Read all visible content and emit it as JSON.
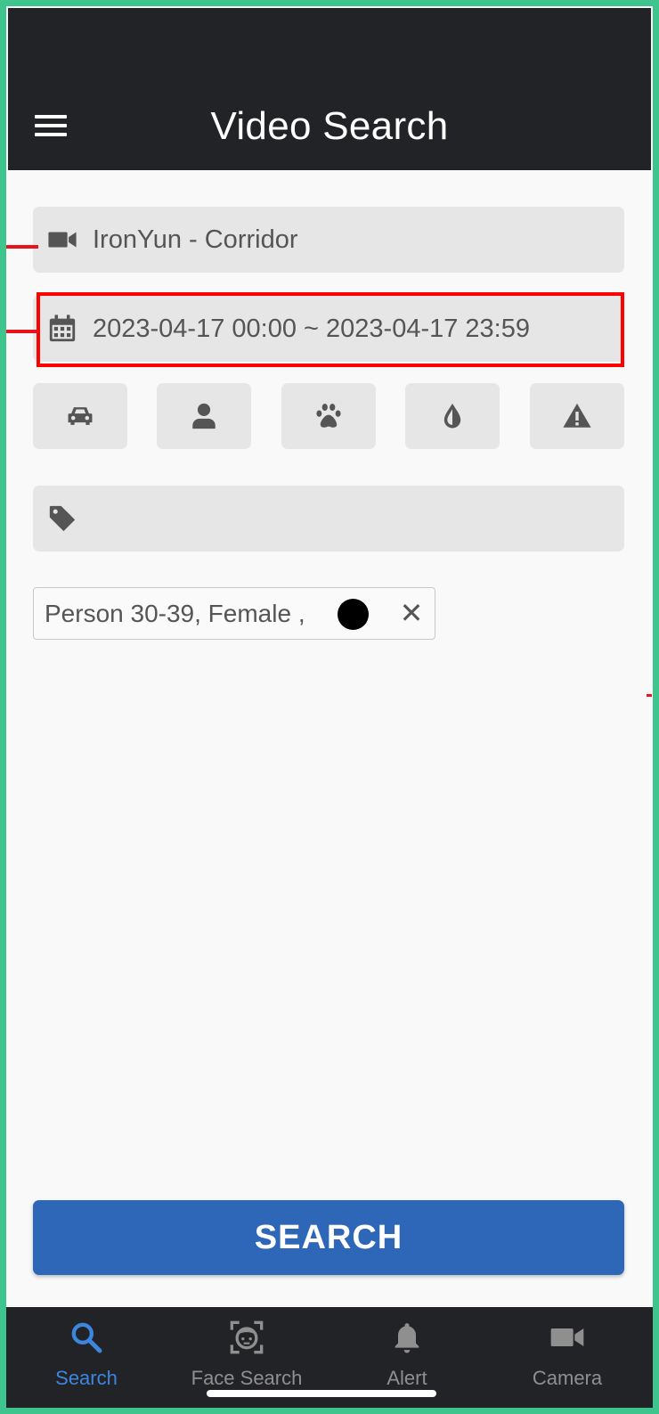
{
  "header": {
    "title": "Video Search"
  },
  "camera_field": {
    "value": "IronYun - Corridor"
  },
  "date_field": {
    "value": "2023-04-17 00:00 ~ 2023-04-17 23:59"
  },
  "categories": [
    {
      "name": "vehicle",
      "icon": "car-icon"
    },
    {
      "name": "person",
      "icon": "person-icon"
    },
    {
      "name": "animal",
      "icon": "paw-icon"
    },
    {
      "name": "liquid",
      "icon": "drop-icon"
    },
    {
      "name": "warning",
      "icon": "warning-icon"
    }
  ],
  "tag_field": {
    "value": ""
  },
  "chip": {
    "label": "Person  30-39, Female ,",
    "close": "✕",
    "color": "#000000"
  },
  "search_button": {
    "label": "SEARCH"
  },
  "bottom_nav": [
    {
      "label": "Search",
      "icon": "search-icon",
      "active": true
    },
    {
      "label": "Face Search",
      "icon": "face-search-icon",
      "active": false
    },
    {
      "label": "Alert",
      "icon": "bell-icon",
      "active": false
    },
    {
      "label": "Camera",
      "icon": "video-camera-icon",
      "active": false
    }
  ],
  "colors": {
    "accent": "#2f67b8",
    "active_nav": "#3d86e0",
    "header_bg": "#222326",
    "frame": "#3ec48d",
    "highlight": "#ff0000"
  }
}
